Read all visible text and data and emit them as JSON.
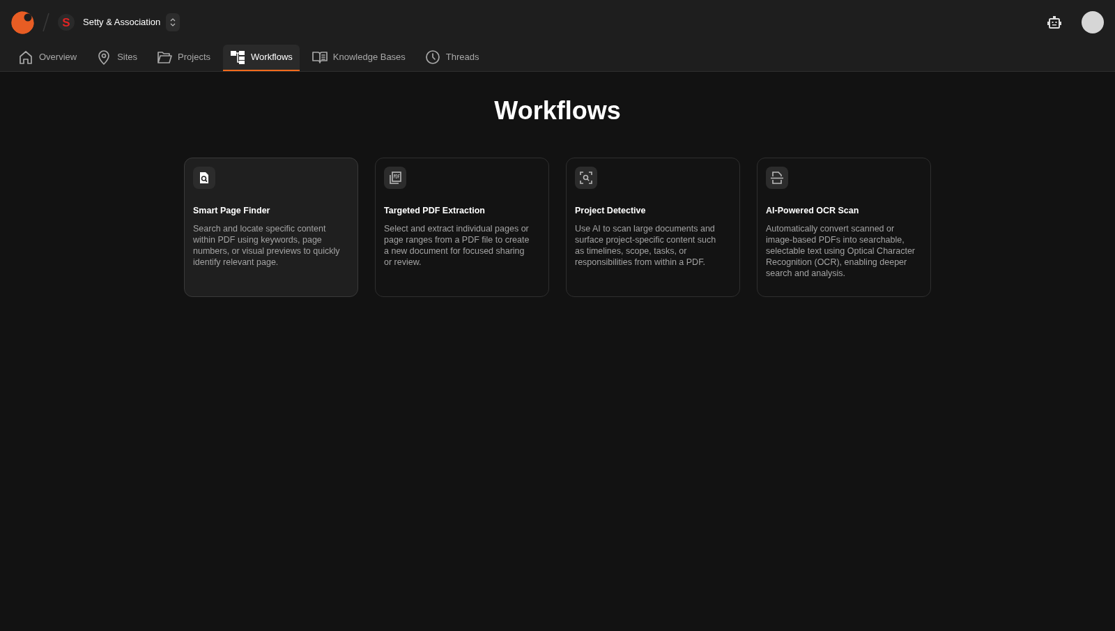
{
  "header": {
    "org": {
      "logo_letter": "S",
      "name": "Setty & Association"
    }
  },
  "tabs": [
    {
      "label": "Overview",
      "kind": "home",
      "selected": false
    },
    {
      "label": "Sites",
      "kind": "pin",
      "selected": false
    },
    {
      "label": "Projects",
      "kind": "folder",
      "selected": false
    },
    {
      "label": "Workflows",
      "kind": "workflow",
      "selected": true
    },
    {
      "label": "Knowledge Bases",
      "kind": "book",
      "selected": false
    },
    {
      "label": "Threads",
      "kind": "clock",
      "selected": false
    }
  ],
  "page_title": "Workflows",
  "cards": [
    {
      "kind": "finder",
      "title": "Smart Page Finder",
      "description": "Search and locate specific content within PDF using keywords, page numbers, or visual previews to quickly identify relevant page.",
      "highlighted": true
    },
    {
      "kind": "extraction",
      "title": "Targeted PDF Extraction",
      "description": "Select and extract individual pages or page ranges from a PDF file to create a new document for focused sharing or review.",
      "highlighted": false
    },
    {
      "kind": "detective",
      "title": "Project Detective",
      "description": "Use AI to scan large documents and surface project-specific content such as timelines, scope, tasks, or responsibilities from within a PDF.",
      "highlighted": false
    },
    {
      "kind": "ocr",
      "title": "AI-Powered OCR Scan",
      "description": "Automatically convert scanned or image-based PDFs into searchable, selectable text using Optical Character Recognition (OCR), enabling deeper search and analysis.",
      "highlighted": false
    }
  ]
}
